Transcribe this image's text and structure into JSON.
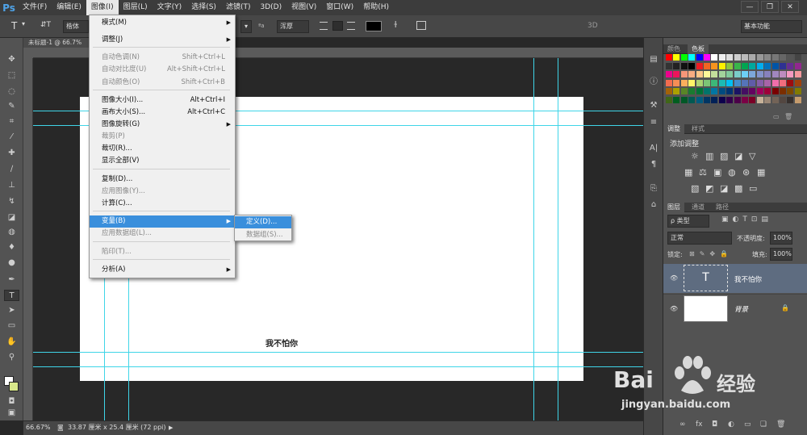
{
  "menubar": {
    "logo": "Ps",
    "items": [
      "文件(F)",
      "编辑(E)",
      "图像(I)",
      "图层(L)",
      "文字(Y)",
      "选择(S)",
      "滤镜(T)",
      "3D(D)",
      "视图(V)",
      "窗口(W)",
      "帮助(H)"
    ],
    "window_controls": [
      "—",
      "❐",
      "✕"
    ]
  },
  "options": {
    "tool_glyph": "T",
    "orient_glyph": "⇵T",
    "font": "楷体",
    "aa_label": "ªa",
    "aa_value": "浑厚",
    "three_d": "3D",
    "workspace": "基本功能"
  },
  "document": {
    "tab_title": "未标题-1 @ 66.7%",
    "canvas_text": "我不怕你",
    "zoom": "66.67%",
    "doc_size": "33.87 厘米 x 25.4 厘米 (72 ppi)"
  },
  "image_menu": {
    "items": [
      {
        "label": "模式(M)",
        "shortcut": "",
        "submenu": true,
        "disabled": false
      },
      {
        "label": "调整(J)",
        "shortcut": "",
        "submenu": true,
        "disabled": false
      },
      {
        "label": "自动色调(N)",
        "shortcut": "Shift+Ctrl+L",
        "disabled": true
      },
      {
        "label": "自动对比度(U)",
        "shortcut": "Alt+Shift+Ctrl+L",
        "disabled": true
      },
      {
        "label": "自动颜色(O)",
        "shortcut": "Shift+Ctrl+B",
        "disabled": true
      },
      {
        "label": "图像大小(I)...",
        "shortcut": "Alt+Ctrl+I",
        "disabled": false
      },
      {
        "label": "画布大小(S)...",
        "shortcut": "Alt+Ctrl+C",
        "disabled": false
      },
      {
        "label": "图像旋转(G)",
        "shortcut": "",
        "submenu": true,
        "disabled": false
      },
      {
        "label": "裁剪(P)",
        "shortcut": "",
        "disabled": true
      },
      {
        "label": "裁切(R)...",
        "shortcut": "",
        "disabled": false
      },
      {
        "label": "显示全部(V)",
        "shortcut": "",
        "disabled": false
      },
      {
        "label": "复制(D)...",
        "shortcut": "",
        "disabled": false
      },
      {
        "label": "应用图像(Y)...",
        "shortcut": "",
        "disabled": true
      },
      {
        "label": "计算(C)...",
        "shortcut": "",
        "disabled": false
      },
      {
        "label": "变量(B)",
        "shortcut": "",
        "submenu": true,
        "disabled": false,
        "highlighted": true
      },
      {
        "label": "应用数据组(L)...",
        "shortcut": "",
        "disabled": true
      },
      {
        "label": "陷印(T)...",
        "shortcut": "",
        "disabled": true
      },
      {
        "label": "分析(A)",
        "shortcut": "",
        "submenu": true,
        "disabled": false
      }
    ]
  },
  "variables_submenu": {
    "items": [
      {
        "label": "定义(D)...",
        "highlighted": true
      },
      {
        "label": "数据组(S)...",
        "disabled": true
      }
    ]
  },
  "panels": {
    "color_tabs": [
      "颜色",
      "色板"
    ],
    "adjust_tabs": [
      "调整",
      "样式"
    ],
    "adjust_title": "添加调整",
    "layers_tabs": [
      "图层",
      "通道",
      "路径"
    ],
    "filter_kind": "ρ 类型",
    "blend_mode": "正常",
    "opacity_label": "不透明度:",
    "opacity_value": "100%",
    "lock_label": "锁定:",
    "fill_label": "填充:",
    "fill_value": "100%",
    "layers": [
      {
        "name": "我不怕你",
        "type": "text",
        "thumb_glyph": "T"
      },
      {
        "name": "背景",
        "type": "background"
      }
    ],
    "bottom_icons": [
      "∞",
      "fx",
      "◘",
      "◐",
      "▭",
      "❏",
      "🗑"
    ]
  },
  "watermark": {
    "brand": "Bai",
    "brand2": "经验",
    "url": "jingyan.baidu.com"
  },
  "colors": {
    "highlight": "#3a8fdc",
    "guide": "#3fd5e8",
    "ps_blue": "#4fa3e8"
  }
}
